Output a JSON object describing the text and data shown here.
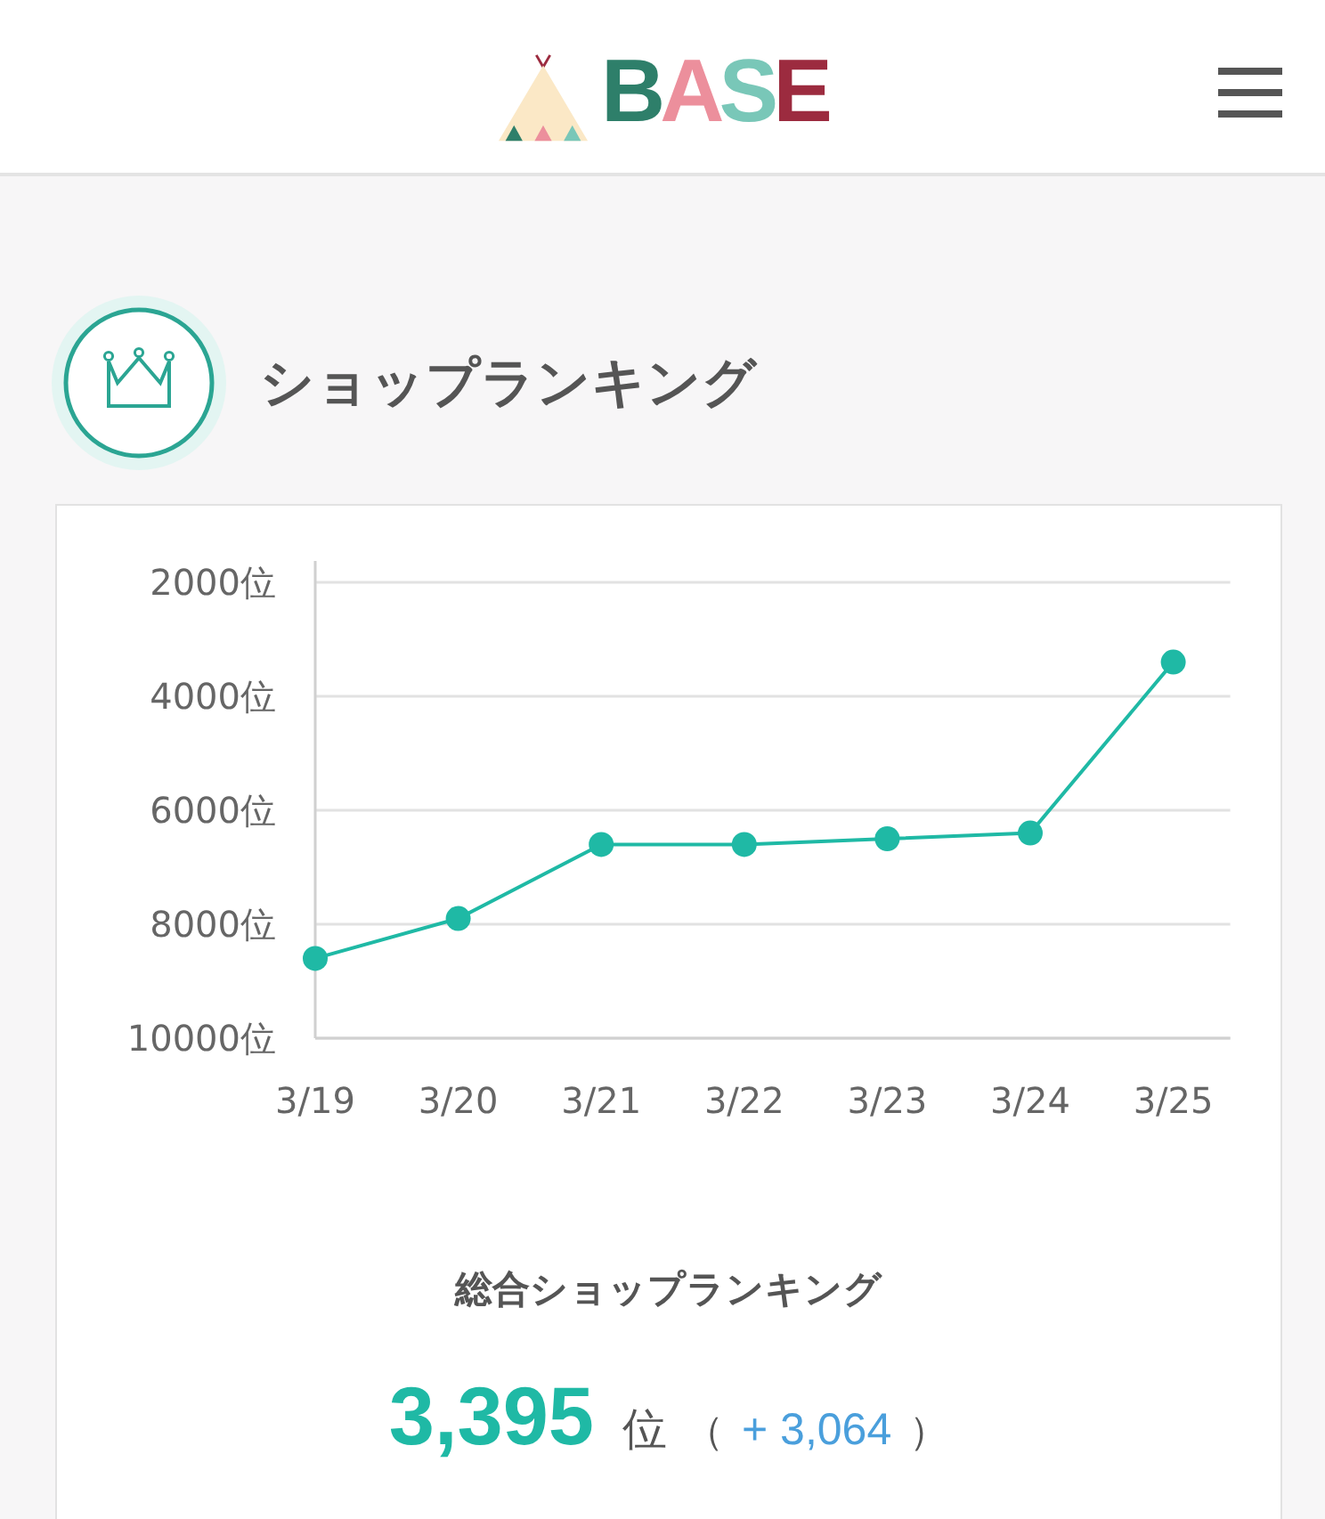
{
  "header": {
    "logo": {
      "letters": [
        {
          "text": "B",
          "color": "#2e7f6a"
        },
        {
          "text": "A",
          "color": "#ec8f9c"
        },
        {
          "text": "S",
          "color": "#79c7b8"
        },
        {
          "text": "E",
          "color": "#9c2b3f"
        }
      ]
    }
  },
  "section": {
    "title": "ショップランキング"
  },
  "chart_data": {
    "type": "line",
    "categories": [
      "3/19",
      "3/20",
      "3/21",
      "3/22",
      "3/23",
      "3/24",
      "3/25"
    ],
    "grid": true,
    "series": [
      {
        "color": "#1fb9a5",
        "marker": true,
        "values": [
          8600,
          7900,
          6600,
          6600,
          6500,
          6400,
          3400
        ]
      }
    ],
    "ylim": [
      10000,
      2000
    ],
    "yticks": [
      {
        "value": 2000,
        "label": "2000位"
      },
      {
        "value": 4000,
        "label": "4000位"
      },
      {
        "value": 6000,
        "label": "6000位"
      },
      {
        "value": 8000,
        "label": "8000位"
      },
      {
        "value": 10000,
        "label": "10000位"
      }
    ]
  },
  "summary": {
    "label": "総合ショップランキング",
    "rank": "3,395",
    "unit": "位",
    "open": "（",
    "change": "+ 3,064",
    "close": "）"
  }
}
